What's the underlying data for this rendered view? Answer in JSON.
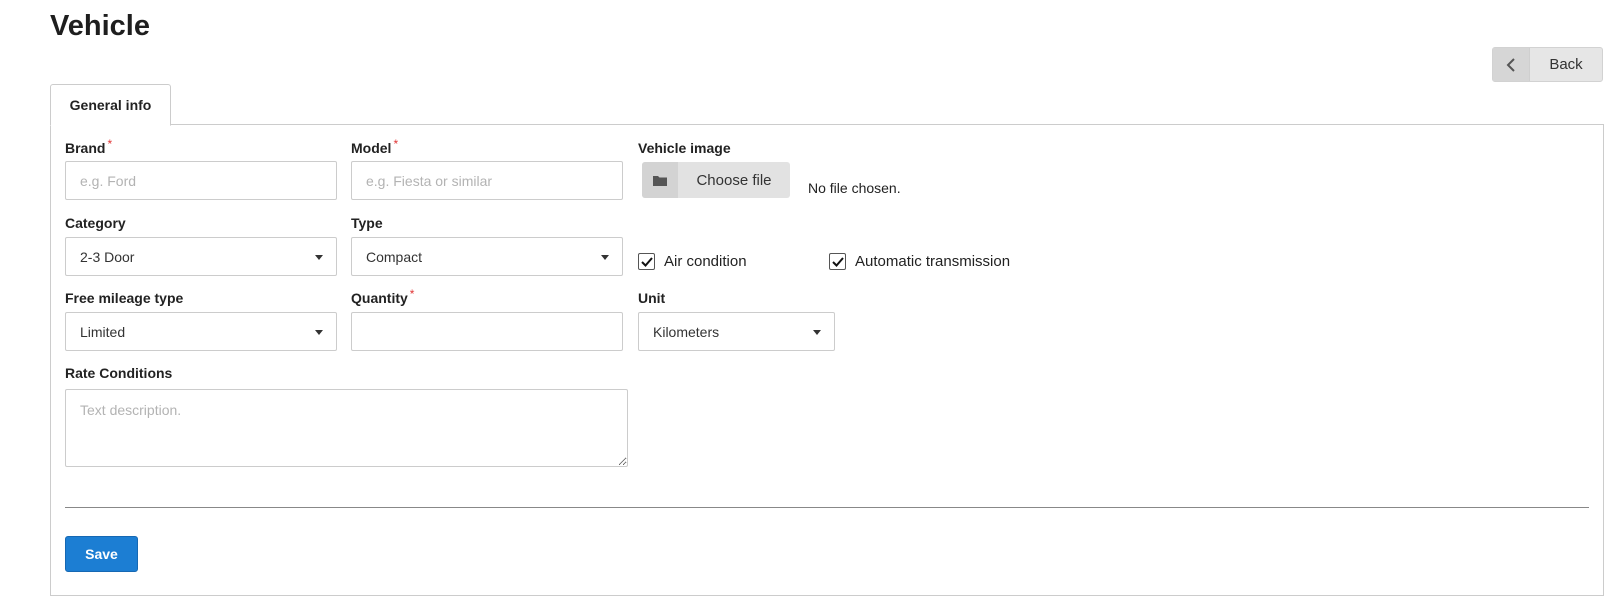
{
  "page": {
    "title": "Vehicle"
  },
  "header": {
    "back_label": "Back"
  },
  "tabs": [
    {
      "label": "General info"
    }
  ],
  "form": {
    "brand": {
      "label": "Brand",
      "required_mark": "*",
      "placeholder": "e.g. Ford",
      "value": ""
    },
    "model": {
      "label": "Model",
      "required_mark": "*",
      "placeholder": "e.g. Fiesta or similar",
      "value": ""
    },
    "vehicle_image": {
      "label": "Vehicle image",
      "button_label": "Choose file",
      "status": "No file chosen."
    },
    "category": {
      "label": "Category",
      "selected": "2-3 Door"
    },
    "type": {
      "label": "Type",
      "selected": "Compact"
    },
    "air_condition": {
      "label": "Air condition",
      "checked": true
    },
    "automatic_transmission": {
      "label": "Automatic transmission",
      "checked": true
    },
    "free_mileage_type": {
      "label": "Free mileage type",
      "selected": "Limited"
    },
    "quantity": {
      "label": "Quantity",
      "required_mark": "*",
      "value": ""
    },
    "unit": {
      "label": "Unit",
      "selected": "Kilometers"
    },
    "rate_conditions": {
      "label": "Rate Conditions",
      "placeholder": "Text description.",
      "value": ""
    }
  },
  "actions": {
    "save_label": "Save"
  },
  "colors": {
    "primary": "#1c7ed3",
    "required": "#e03434",
    "button_gray": "#e2e2e2"
  },
  "icons": {
    "back": "chevron-left-icon",
    "file": "folder-icon",
    "check": "check-icon",
    "select": "caret-down-icon"
  }
}
